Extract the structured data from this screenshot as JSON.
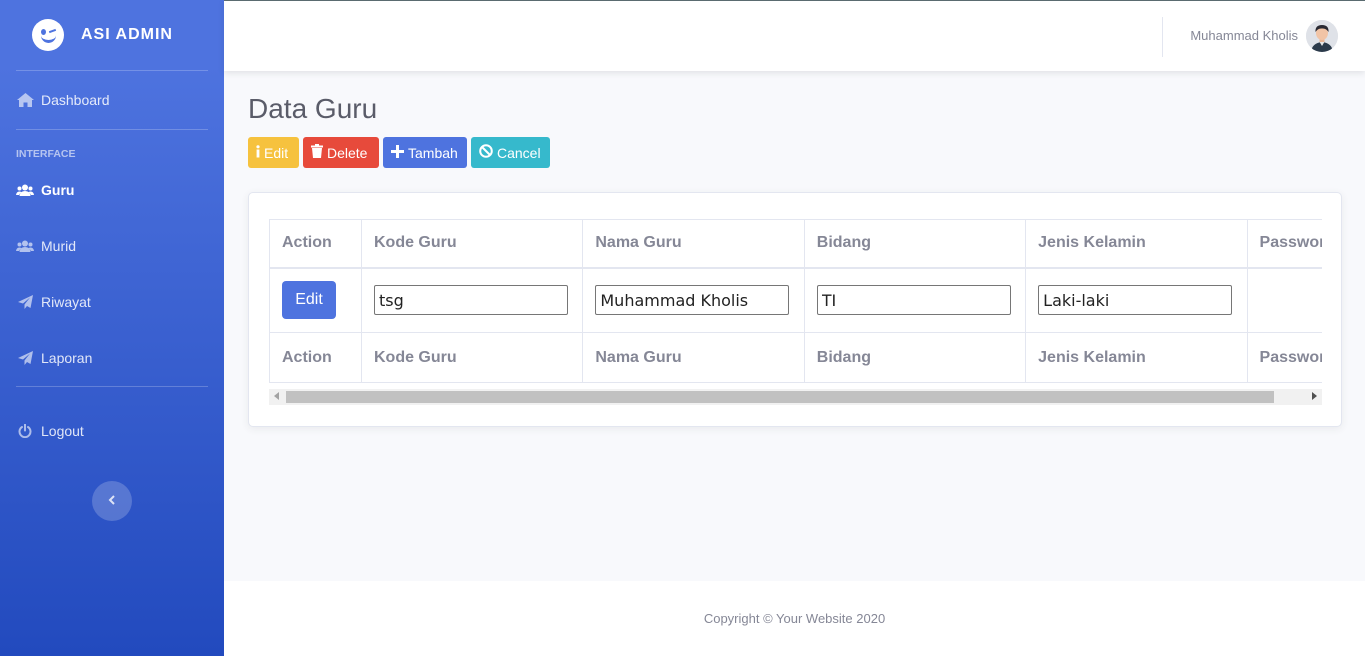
{
  "brand": {
    "name": "ASI ADMIN",
    "icon": "laugh-wink-icon"
  },
  "sidebar": {
    "dashboard": {
      "label": "Dashboard",
      "icon": "home-icon"
    },
    "heading": "INTERFACE",
    "items": [
      {
        "label": "Guru",
        "icon": "users-icon",
        "active": true
      },
      {
        "label": "Murid",
        "icon": "users-icon",
        "active": false
      },
      {
        "label": "Riwayat",
        "icon": "paper-plane-icon",
        "active": false
      },
      {
        "label": "Laporan",
        "icon": "paper-plane-icon",
        "active": false
      }
    ],
    "logout": {
      "label": "Logout",
      "icon": "power-icon"
    },
    "toggle_icon": "chevron-left-icon"
  },
  "topbar": {
    "user_name": "Muhammad Kholis"
  },
  "page": {
    "title": "Data Guru",
    "buttons": {
      "edit": "Edit",
      "delete": "Delete",
      "add": "Tambah",
      "cancel": "Cancel"
    }
  },
  "table": {
    "headers": [
      "Action",
      "Kode Guru",
      "Nama Guru",
      "Bidang",
      "Jenis Kelamin",
      "Password"
    ],
    "row": {
      "action_label": "Edit",
      "kode_guru": "tsg",
      "nama_guru": "Muhammad Kholis",
      "bidang": "TI",
      "jenis_kelamin": "Laki-laki"
    }
  },
  "footer": {
    "text": "Copyright © Your Website 2020"
  },
  "colors": {
    "primary": "#4e73df",
    "warning": "#f6c23e",
    "danger": "#e74a3b",
    "info": "#36b9cc"
  }
}
